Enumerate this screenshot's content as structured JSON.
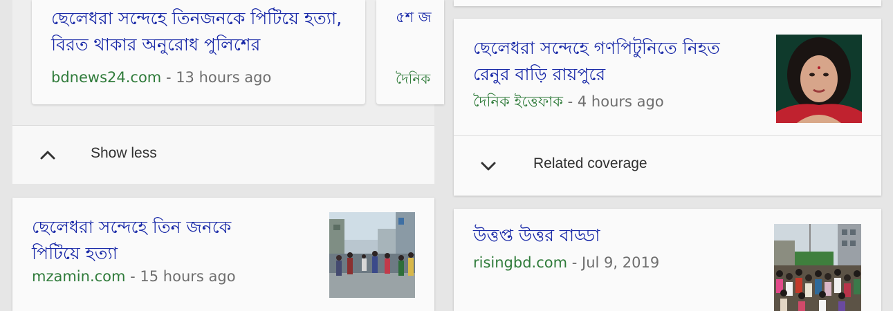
{
  "left_column": {
    "cluster_card": {
      "article": {
        "title_line1": "ছেলেধরা সন্দেহে তিনজনকে পিটিয়ে হত্যা,",
        "title_line2": "বিরত থাকার অনুরোধ পুলিশের",
        "source": "bdnews24.com",
        "time": " - 13 hours ago"
      },
      "peek_card": {
        "title_fragment": "৫শ জ",
        "source_fragment": "দৈনিক"
      },
      "show_less": {
        "label": "Show less",
        "icon": "chevron-up-icon"
      }
    },
    "story_card": {
      "title_line1": "ছেলেধরা সন্দেহে তিন জনকে",
      "title_line2": "পিটিয়ে হত্যা",
      "source": "mzamin.com",
      "time": " - 15 hours ago",
      "thumbnail": "street-crowd-photo"
    }
  },
  "right_column": {
    "story_card_1": {
      "title_line1": "ছেলেধরা সন্দেহে গণপিটুনিতে নিহত",
      "title_line2": "রেনুর বাড়ি রায়পুরে",
      "source": "দৈনিক ইত্তেফাক",
      "time": " - 4 hours ago",
      "thumbnail": "woman-portrait-photo",
      "related": {
        "label": "Related coverage",
        "icon": "chevron-down-icon"
      }
    },
    "story_card_2": {
      "title": "উত্তপ্ত উত্তর বাড্ডা",
      "source": "risingbd.com",
      "time": " - Jul 9, 2019",
      "thumbnail": "protest-crowd-photo"
    }
  },
  "colors": {
    "title_blue": "#1a2aa8",
    "source_green": "#2f7b3a",
    "meta_gray": "#6e6e6e",
    "background": "#e6e6e6",
    "card": "#fafafa"
  }
}
